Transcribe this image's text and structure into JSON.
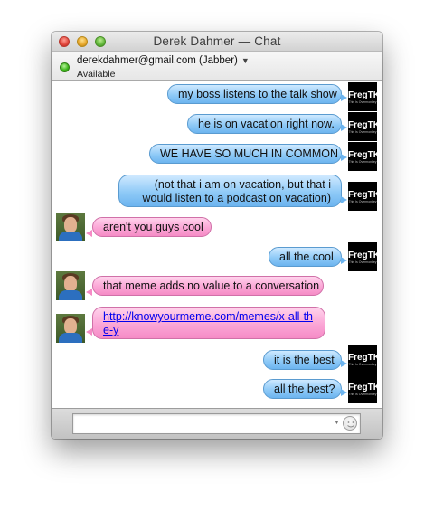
{
  "window": {
    "title": "Derek Dahmer — Chat"
  },
  "status": {
    "account": "derekdahmer@gmail.com (Jabber)",
    "availability": "Available",
    "status_color": "#3fb81e"
  },
  "avatars": {
    "me": {
      "name": "FregTK",
      "tagline": "This Is Overmonkey"
    }
  },
  "messages": [
    {
      "sender": "me",
      "text": "my boss listens to the talk show"
    },
    {
      "sender": "me",
      "text": "he is on vacation right now."
    },
    {
      "sender": "me",
      "text": "WE HAVE SO MUCH IN COMMON"
    },
    {
      "sender": "me",
      "text": "(not that i am on vacation, but that i would listen to a podcast on vacation)"
    },
    {
      "sender": "them",
      "text": "aren't you guys cool"
    },
    {
      "sender": "me",
      "text": "all the cool"
    },
    {
      "sender": "them",
      "text": "that meme adds no value to a conversation"
    },
    {
      "sender": "them",
      "text": "http://knowyourmeme.com/memes/x-all-the-y"
    },
    {
      "sender": "me",
      "text": "it is the best"
    },
    {
      "sender": "me",
      "text": "all the best?"
    }
  ],
  "colors": {
    "my_bubble": "#8fcaf7",
    "their_bubble": "#fba6d6",
    "link": "#0000ee"
  },
  "input": {
    "value": "",
    "placeholder": ""
  },
  "icons": {
    "emoticon": "smiley-icon"
  }
}
